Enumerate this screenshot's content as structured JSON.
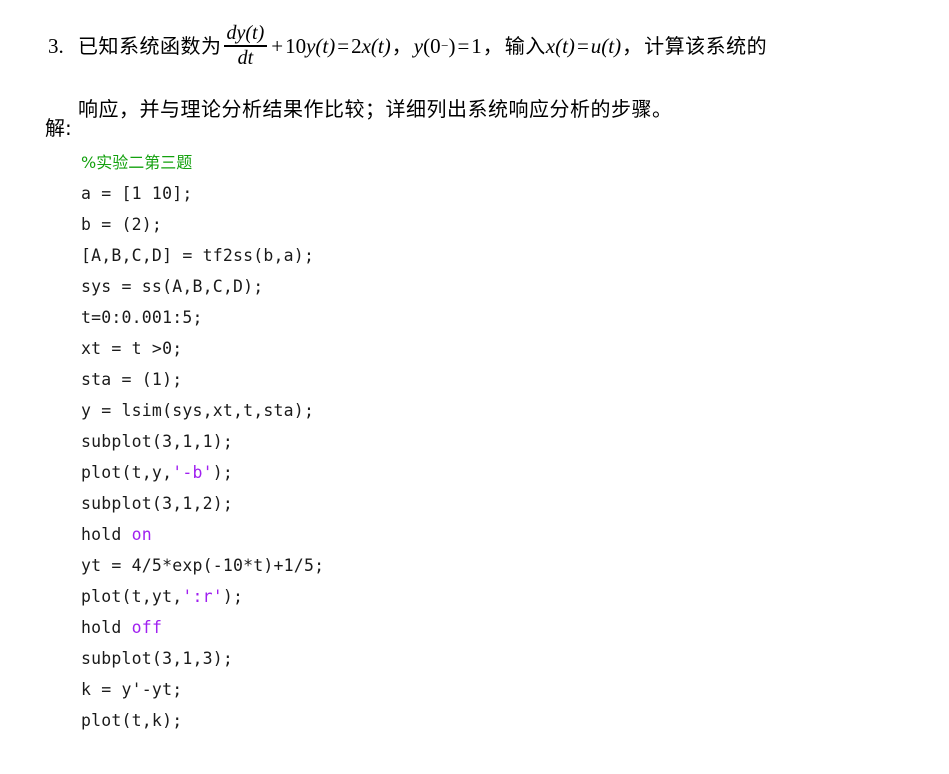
{
  "problem": {
    "number": "3.",
    "text_before_math": "已知系统函数为",
    "equation": {
      "fraction_numerator": "dy(t)",
      "fraction_denominator": "dt",
      "plus": "+",
      "coefficient": "10",
      "y_of_t": "y(t)",
      "equals": "=",
      "rhs_coefficient": "2",
      "x_of_t": "x(t)"
    },
    "comma_1": "，",
    "initial_condition": {
      "y": "y",
      "open": "(",
      "zero": "0",
      "minus": "−",
      "close": ")",
      "equals": "=",
      "value": "1"
    },
    "comma_2": "，",
    "text_input_label": "输入",
    "input_equation": {
      "x_of_t": "x(t)",
      "equals": "=",
      "u_of_t": "u(t)"
    },
    "comma_3": "，",
    "text_after": "计算该系统的",
    "line2": "响应，并与理论分析结果作比较；详细列出系统响应分析的步骤。"
  },
  "solution": {
    "label": "解:",
    "code_lines": [
      {
        "tokens": [
          {
            "text": "%实验二第三题",
            "type": "comment"
          }
        ]
      },
      {
        "tokens": [
          {
            "text": "a = [1 10];",
            "type": "plain"
          }
        ]
      },
      {
        "tokens": [
          {
            "text": "b = (2);",
            "type": "plain"
          }
        ]
      },
      {
        "tokens": [
          {
            "text": "[A,B,C,D] = tf2ss(b,a);",
            "type": "plain"
          }
        ]
      },
      {
        "tokens": [
          {
            "text": "sys = ss(A,B,C,D);",
            "type": "plain"
          }
        ]
      },
      {
        "tokens": [
          {
            "text": "t=0:0.001:5;",
            "type": "plain"
          }
        ]
      },
      {
        "tokens": [
          {
            "text": "xt = t >0;",
            "type": "plain"
          }
        ]
      },
      {
        "tokens": [
          {
            "text": "sta = (1);",
            "type": "plain"
          }
        ]
      },
      {
        "tokens": [
          {
            "text": "y = lsim(sys,xt,t,sta);",
            "type": "plain"
          }
        ]
      },
      {
        "tokens": [
          {
            "text": "subplot(3,1,1);",
            "type": "plain"
          }
        ]
      },
      {
        "tokens": [
          {
            "text": "plot(t,y,",
            "type": "plain"
          },
          {
            "text": "'-b'",
            "type": "string"
          },
          {
            "text": ");",
            "type": "plain"
          }
        ]
      },
      {
        "tokens": [
          {
            "text": "subplot(3,1,2);",
            "type": "plain"
          }
        ]
      },
      {
        "tokens": [
          {
            "text": "hold ",
            "type": "plain"
          },
          {
            "text": "on",
            "type": "keyword"
          }
        ]
      },
      {
        "tokens": [
          {
            "text": "yt = 4/5*exp(-10*t)+1/5;",
            "type": "plain"
          }
        ]
      },
      {
        "tokens": [
          {
            "text": "plot(t,yt,",
            "type": "plain"
          },
          {
            "text": "':r'",
            "type": "string"
          },
          {
            "text": ");",
            "type": "plain"
          }
        ]
      },
      {
        "tokens": [
          {
            "text": "hold ",
            "type": "plain"
          },
          {
            "text": "off",
            "type": "keyword"
          }
        ]
      },
      {
        "tokens": [
          {
            "text": "subplot(3,1,3);",
            "type": "plain"
          }
        ]
      },
      {
        "tokens": [
          {
            "text": "k = y'-yt;",
            "type": "plain"
          }
        ]
      },
      {
        "tokens": [
          {
            "text": "plot(t,k);",
            "type": "plain"
          }
        ]
      }
    ]
  },
  "colors": {
    "background": "#ffffff",
    "text": "#000000",
    "code_plain": "#1a1a1a",
    "code_comment": "#13a10e",
    "code_string": "#a020f0",
    "code_keyword": "#a020f0"
  }
}
